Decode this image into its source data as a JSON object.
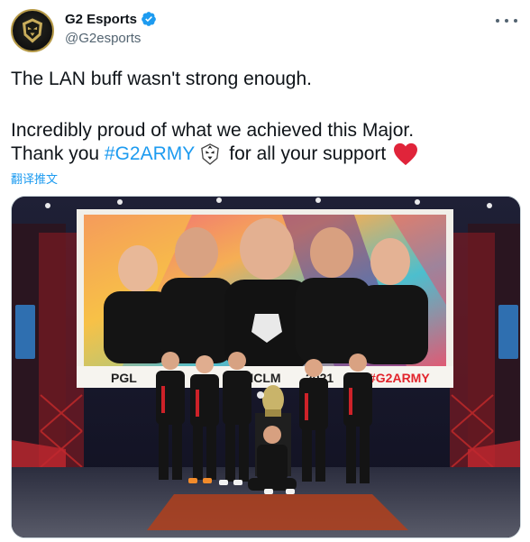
{
  "author": {
    "display_name": "G2 Esports",
    "handle": "@G2esports",
    "avatar_icon": "g2-samurai-logo-icon",
    "verified_icon": "verified-badge-icon"
  },
  "tweet": {
    "line1": "The LAN buff wasn't strong enough.",
    "line2": "Incredibly proud of what we achieved this Major.",
    "line3_prefix": "Thank you ",
    "hashtag": "#G2ARMY",
    "line3_suffix": "for all your support",
    "translate_label": "翻译推文"
  },
  "media": {
    "screen_left_text": "PGL",
    "screen_middle_text": "KHCLM",
    "screen_year_text": "2021",
    "screen_right_text": "#G2ARMY"
  },
  "colors": {
    "accent": "#1d9bf0",
    "text": "#0f1419",
    "secondary": "#536471",
    "heart": "#f91880",
    "g2_red": "#e2232b"
  }
}
